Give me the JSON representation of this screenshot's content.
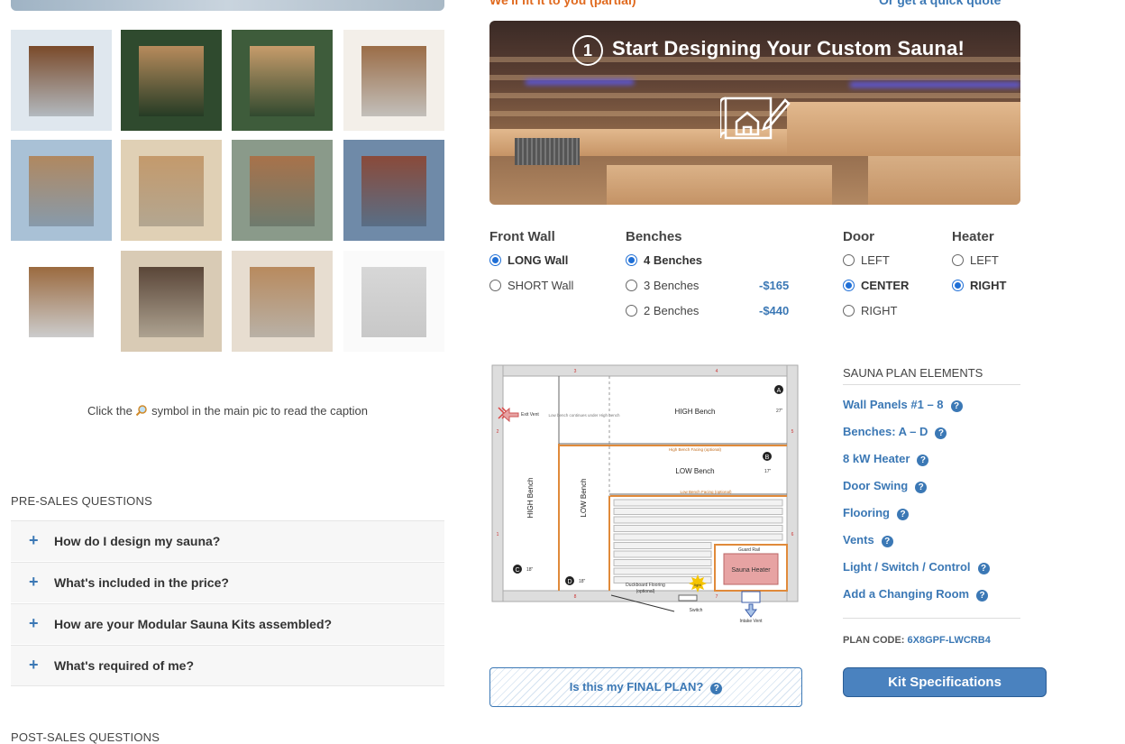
{
  "top": {
    "left_link": "We'll fit it to you (partial)",
    "right_link": "Or get a quick quote"
  },
  "gallery": {
    "caption_hint_before": "Click the",
    "caption_hint_icon": "magnifier-icon",
    "caption_hint_after": "symbol in the main pic to read the caption"
  },
  "presales": {
    "title": "PRE-SALES QUESTIONS",
    "questions": [
      "How do I design my sauna?",
      "What's included in the price?",
      "How are your Modular Sauna Kits assembled?",
      "What's required of me?"
    ]
  },
  "postsales": {
    "title": "POST-SALES QUESTIONS"
  },
  "hero": {
    "step": "1",
    "title": "Start Designing Your Custom Sauna!"
  },
  "options": {
    "front_wall": {
      "label": "Front Wall",
      "choices": [
        {
          "label": "LONG Wall",
          "selected": true
        },
        {
          "label": "SHORT Wall",
          "selected": false
        }
      ]
    },
    "benches": {
      "label": "Benches",
      "choices": [
        {
          "label": "4 Benches",
          "selected": true,
          "price": ""
        },
        {
          "label": "3 Benches",
          "selected": false,
          "price": "-$165"
        },
        {
          "label": "2 Benches",
          "selected": false,
          "price": "-$440"
        }
      ]
    },
    "door": {
      "label": "Door",
      "choices": [
        {
          "label": "LEFT",
          "selected": false
        },
        {
          "label": "CENTER",
          "selected": true
        },
        {
          "label": "RIGHT",
          "selected": false
        }
      ]
    },
    "heater": {
      "label": "Heater",
      "choices": [
        {
          "label": "LEFT",
          "selected": false
        },
        {
          "label": "RIGHT",
          "selected": true
        }
      ]
    }
  },
  "plan": {
    "labels": {
      "high_bench": "HIGH Bench",
      "low_bench": "LOW Bench",
      "high_bench_vertical": "HIGH Bench",
      "low_bench_vertical": "LOW Bench",
      "exit_vent": "Exit Vent",
      "sauna_heater": "Sauna Heater",
      "guard_rail": "Guard Rail",
      "duckboard": "Duckboard Flooring",
      "duckboard_opt": "(optional)",
      "switch": "Switch",
      "intake_vent": "Intake Vent",
      "high_facing": "High Bench Facing (optional)",
      "low_facing": "Low Bench Facing (optional)",
      "low_bench_note": "Low bench continues under High bench",
      "dim_27": "27\"",
      "dim_17": "17\"",
      "dim_18a": "18\"",
      "dim_18b": "18\"",
      "marker_a": "A",
      "marker_b": "B",
      "marker_c": "C",
      "marker_d": "D",
      "panel_1": "1",
      "panel_2": "2",
      "panel_3": "3",
      "panel_4": "4",
      "panel_5": "5",
      "panel_6": "6",
      "panel_7": "7",
      "panel_8": "8",
      "light": "light"
    }
  },
  "plan_elements": {
    "title": "SAUNA PLAN ELEMENTS",
    "items": [
      "Wall Panels #1 – 8",
      "Benches: A – D",
      "8 kW Heater",
      "Door Swing",
      "Flooring",
      "Vents",
      "Light / Switch / Control",
      "Add a Changing Room"
    ],
    "help_glyph": "?",
    "plan_code_label": "PLAN CODE:",
    "plan_code_value": "6X8GPF-LWCRB4"
  },
  "final_plan": {
    "label": "Is this my FINAL PLAN?"
  },
  "kit_button": {
    "label": "Kit Specifications"
  },
  "colors": {
    "accent_blue": "#3b78b5",
    "accent_orange": "#e06a1f",
    "radio_blue": "#1f6fd6"
  }
}
